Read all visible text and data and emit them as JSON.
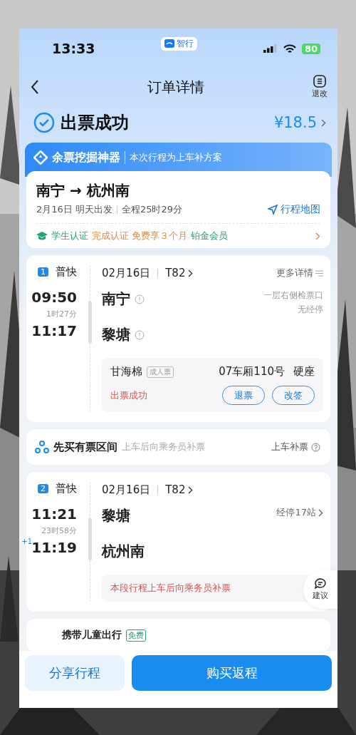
{
  "status_bar": {
    "time": "13:33",
    "app_badge": "智行",
    "battery": "80"
  },
  "nav": {
    "title": "订单详情",
    "action": "退改"
  },
  "order": {
    "status": "出票成功",
    "price": "¥18.5"
  },
  "banner": {
    "brand": "余票挖掘神器",
    "text": "本次行程为上车补方案"
  },
  "route": {
    "title": "南宁 → 杭州南",
    "date": "2月16日 明天出发",
    "duration": "全程25时29分",
    "map_link": "行程地图",
    "promo": {
      "tag": "学生认证",
      "text": "完成认证 免费享３个月",
      "highlight": "铂金会员"
    }
  },
  "segments": [
    {
      "index": "1",
      "type": "普快",
      "date": "02月16日",
      "train": "T82",
      "depart_time": "09:50",
      "travel_time": "1时27分",
      "arrive_time": "11:17",
      "from": "南宁",
      "to": "黎塘",
      "more": "更多详情",
      "side_info": [
        "一层右侧检票口",
        "无经停"
      ],
      "from_info": true,
      "ticket": {
        "kind": "ticket",
        "passenger": "甘海棉",
        "ticket_type": "成人票",
        "seat": "07车厢110号",
        "seat_class": "硬座",
        "status": "出票成功",
        "buttons": [
          "退票",
          "改签"
        ]
      }
    },
    {
      "index": "2",
      "type": "普快",
      "date": "02月16日",
      "train": "T82",
      "depart_time": "11:21",
      "travel_time": "23时58分",
      "arrive_time": "11:19",
      "next_day": "+1",
      "from": "黎塘",
      "to": "杭州南",
      "from_info": false,
      "stops_link": "经停17站",
      "ticket": {
        "kind": "notice",
        "status": "本段行程上车后向乘务员补票"
      }
    }
  ],
  "buy_section": {
    "title": "先买有票区间",
    "hint": "上车后向乘务员补票",
    "link": "上车补票"
  },
  "child_travel": {
    "title": "携带儿童出行",
    "badge": "免费"
  },
  "feedback": {
    "label": "建议"
  },
  "footer": {
    "buttons": [
      {
        "label": "分享行程",
        "kind": "secondary"
      },
      {
        "label": "购买返程",
        "kind": "primary"
      }
    ]
  }
}
